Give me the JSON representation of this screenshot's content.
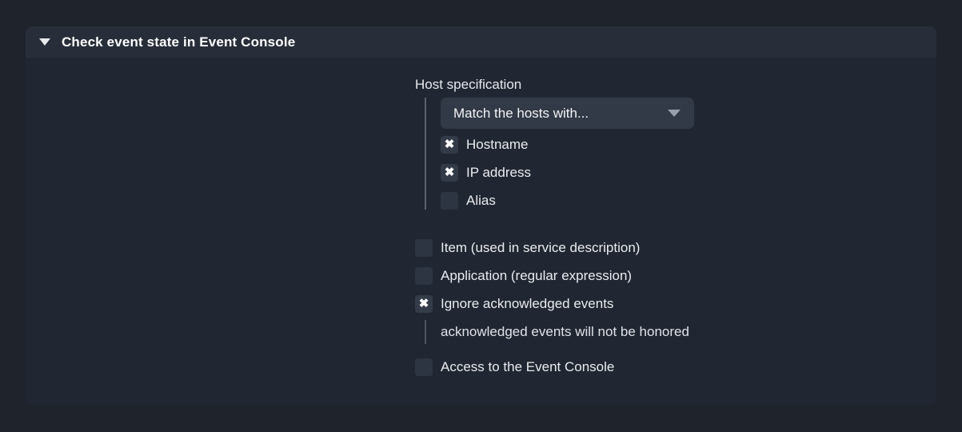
{
  "panel": {
    "title": "Check event state in Event Console",
    "collapse_icon": "triangle-down-icon",
    "expanded": true
  },
  "form": {
    "host_specification": {
      "label": "Host specification",
      "dropdown": {
        "value": "Match the hosts with...",
        "arrow_icon": "chevron-down-icon"
      },
      "options": [
        {
          "label": "Hostname",
          "checked": true
        },
        {
          "label": "IP address",
          "checked": true
        },
        {
          "label": "Alias",
          "checked": false
        }
      ]
    },
    "options": [
      {
        "label": "Item (used in service description)",
        "checked": false
      },
      {
        "label": "Application (regular expression)",
        "checked": false
      },
      {
        "label": "Ignore acknowledged events",
        "checked": true,
        "hint": "acknowledged events will not be honored"
      },
      {
        "label": "Access to the Event Console",
        "checked": false
      }
    ],
    "check_mark": "✖"
  },
  "colors": {
    "page_background": "#1e232c",
    "panel_body": "#212732",
    "panel_header": "#272e39",
    "dropdown_background": "#323a47",
    "checkbox_background": "#2d3542",
    "text_primary": "#e9ebef",
    "title_text": "#ffffff",
    "rule": "#5a626e"
  }
}
